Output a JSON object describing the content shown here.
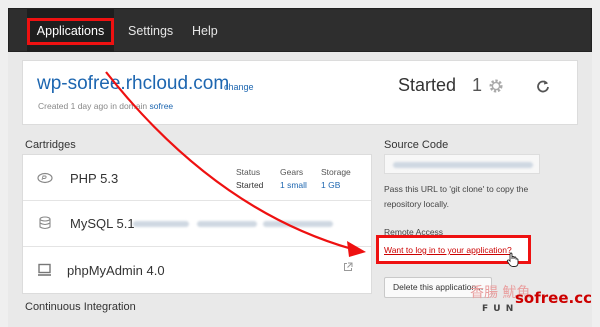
{
  "nav": {
    "items": [
      "Applications",
      "Settings",
      "Help"
    ]
  },
  "app": {
    "name": "wp-sofree.rhcloud.com",
    "change_label": "change",
    "created_prefix": "Created 1 day ago in domain",
    "owner": "sofree",
    "status": "Started",
    "gear_count": "1"
  },
  "cartridges": {
    "title": "Cartridges",
    "items": [
      {
        "name": "PHP 5.3",
        "status_label": "Status",
        "status": "Started",
        "gears_label": "Gears",
        "gears": "1 small",
        "storage_label": "Storage",
        "storage": "1 GB",
        "icon": "php-icon"
      },
      {
        "name": "MySQL 5.1",
        "icon": "database-icon"
      },
      {
        "name": "phpMyAdmin 4.0",
        "icon": "monitor-icon"
      }
    ]
  },
  "ci": {
    "title": "Continuous Integration"
  },
  "source": {
    "title": "Source Code",
    "help": "Pass this URL to 'git clone' to copy the repository locally."
  },
  "remote": {
    "title": "Remote Access",
    "link": "Want to log in to your application?"
  },
  "delete_label": "Delete this application...",
  "watermark": {
    "cjk": "香腸 魷魚",
    "fun": "F U N",
    "brand": "sofree.cc"
  },
  "colors": {
    "highlight": "#e11111",
    "link": "#1d66b0",
    "nav_bg": "#2e2e2e"
  }
}
